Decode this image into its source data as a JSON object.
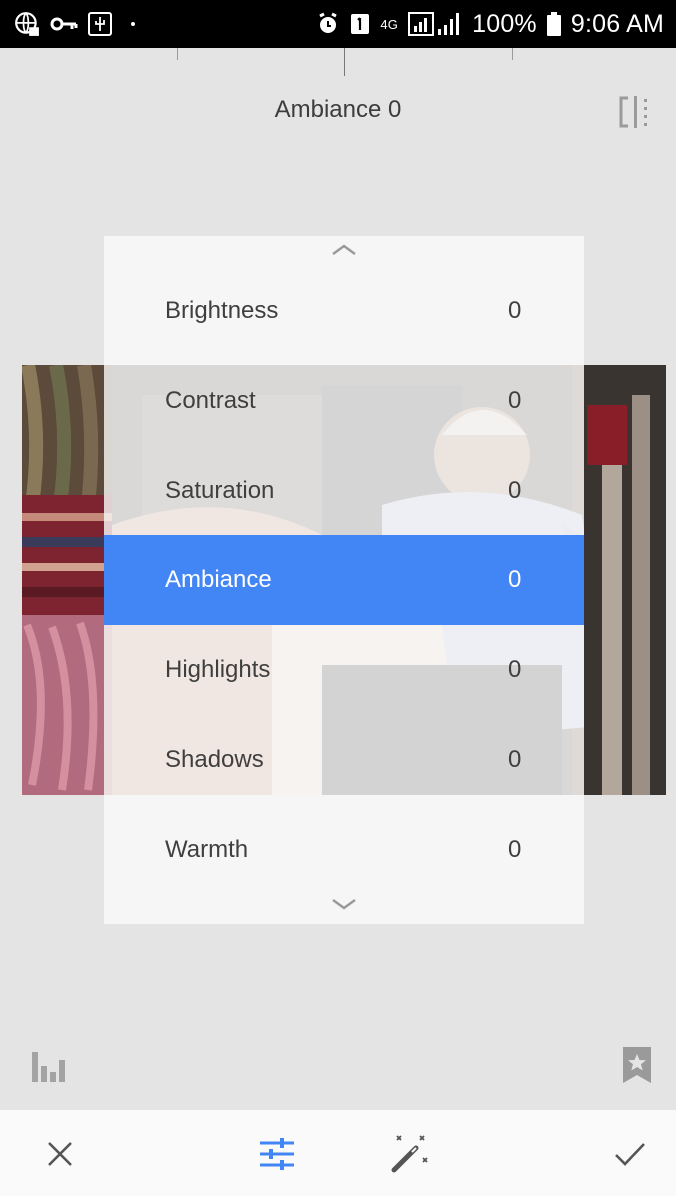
{
  "status_bar": {
    "battery_percent": "100%",
    "time": "9:06 AM",
    "network_label": "4G",
    "left_icons": [
      "globe-lock-icon",
      "key-icon",
      "usb-icon",
      "dot-icon"
    ],
    "right_icons": [
      "alarm-icon",
      "sim-icon",
      "signal-icon",
      "battery-icon"
    ]
  },
  "header": {
    "title": "Ambiance 0",
    "compare_icon": "compare-icon"
  },
  "adjust_menu": {
    "up_icon": "chevron-up-icon",
    "down_icon": "chevron-down-icon",
    "items": [
      {
        "label": "Brightness",
        "value": "0"
      },
      {
        "label": "Contrast",
        "value": "0"
      },
      {
        "label": "Saturation",
        "value": "0"
      },
      {
        "label": "Ambiance",
        "value": "0",
        "selected": true
      },
      {
        "label": "Highlights",
        "value": "0"
      },
      {
        "label": "Shadows",
        "value": "0"
      },
      {
        "label": "Warmth",
        "value": "0"
      }
    ]
  },
  "side_icons": {
    "histogram": "histogram-icon",
    "styles": "star-bookmark-icon"
  },
  "bottom_bar": {
    "cancel": "close-icon",
    "adjust": "sliders-icon",
    "auto": "magic-wand-icon",
    "apply": "check-icon",
    "accent_color": "#4285f4"
  }
}
